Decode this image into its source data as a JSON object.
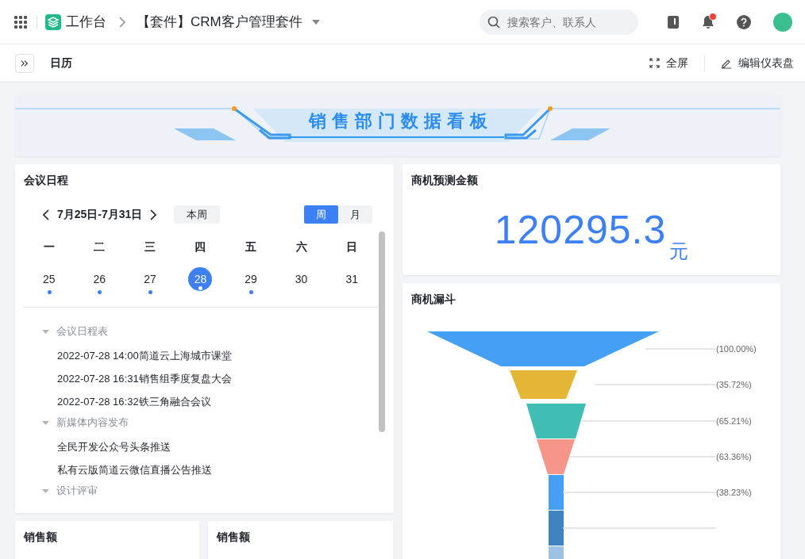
{
  "topbar": {
    "app_name": "工作台",
    "breadcrumb": "【套件】CRM客户管理套件",
    "search": {
      "placeholder": "搜索客户、联系人"
    },
    "notification_badge": true
  },
  "subbar": {
    "title": "日历",
    "actions": [
      {
        "kind": "fullscreen",
        "label": "全屏"
      },
      {
        "kind": "edit",
        "label": "编辑仪表盘"
      }
    ]
  },
  "banner": {
    "title": "销售部门数据看板"
  },
  "schedule": {
    "title": "会议日程",
    "range": "7月25日-7月31日",
    "today_button": "本周",
    "views": [
      {
        "label": "周",
        "selected": true
      },
      {
        "label": "月",
        "selected": false
      }
    ],
    "weekdays": [
      "一",
      "二",
      "三",
      "四",
      "五",
      "六",
      "日"
    ],
    "days": [
      {
        "date": "25",
        "selected": false,
        "has_events": true
      },
      {
        "date": "26",
        "selected": false,
        "has_events": true
      },
      {
        "date": "27",
        "selected": false,
        "has_events": true
      },
      {
        "date": "28",
        "selected": true,
        "has_events": true
      },
      {
        "date": "29",
        "selected": false,
        "has_events": true
      },
      {
        "date": "30",
        "selected": false,
        "has_events": false
      },
      {
        "date": "31",
        "selected": false,
        "has_events": false
      }
    ],
    "groups": [
      {
        "name": "会议日程表",
        "expanded": true,
        "children": [
          {
            "name": "2022-07-28 14:00简道云上海城市课堂"
          },
          {
            "name": "2022-07-28 16:31销售组季度复盘大会"
          },
          {
            "name": "2022-07-28 16:32铁三角融合会议"
          }
        ]
      },
      {
        "name": "新媒体内容发布",
        "expanded": true,
        "children": [
          {
            "name": "全民开发公众号头条推送"
          },
          {
            "name": "私有云版简道云微信直播公告推送"
          }
        ]
      },
      {
        "name": "设计评审",
        "expanded": true
      }
    ]
  },
  "forecast": {
    "title": "商机预测金额",
    "value": "120295.3",
    "unit": "元"
  },
  "funnel": {
    "title": "商机漏斗",
    "stages": [
      {
        "label": "(100.00%)",
        "color": "#45a0f5"
      },
      {
        "label": "(35.72%)",
        "color": "#e5b535"
      },
      {
        "label": "(65.21%)",
        "color": "#41beb4"
      },
      {
        "label": "(63.36%)",
        "color": "#f6958a"
      },
      {
        "label": "(38.23%)",
        "color": "#45a0f5"
      },
      {
        "color": "#3f83bf"
      },
      {
        "color": "#9cc3e4"
      }
    ]
  },
  "sales": [
    {
      "title": "销售额"
    },
    {
      "title": "销售额"
    }
  ]
}
